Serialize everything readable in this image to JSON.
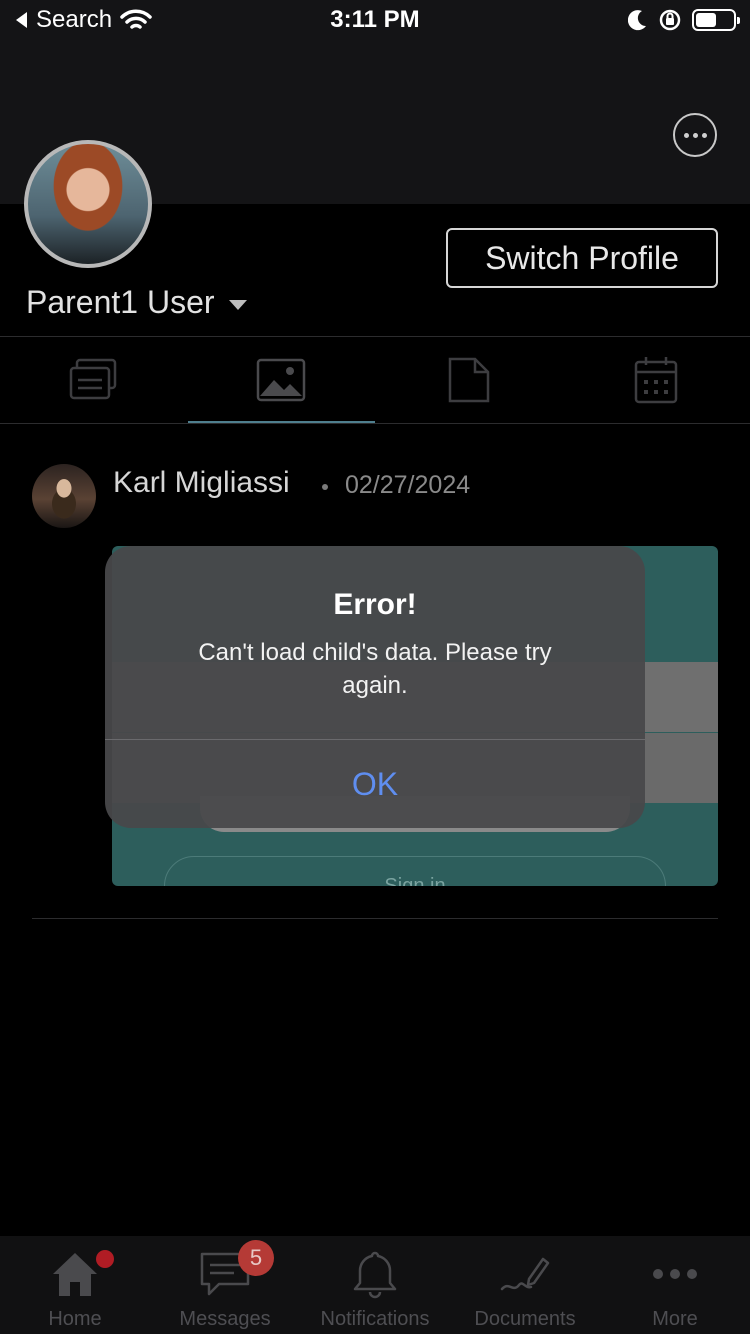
{
  "status_bar": {
    "back_label": "Search",
    "time": "3:11 PM"
  },
  "profile": {
    "name": "Parent1 User",
    "switch_label": "Switch Profile"
  },
  "tabs": [
    {
      "icon": "feed-icon",
      "active": false
    },
    {
      "icon": "image-icon",
      "active": true
    },
    {
      "icon": "document-icon",
      "active": false
    },
    {
      "icon": "calendar-icon",
      "active": false
    }
  ],
  "post": {
    "author": "Karl Migliassi",
    "date": "02/27/2024",
    "image_button_label": "Sign in"
  },
  "alert": {
    "title": "Error!",
    "message": "Can't load child's data. Please try again.",
    "ok_label": "OK"
  },
  "bottom_nav": {
    "home": "Home",
    "messages": "Messages",
    "messages_badge": "5",
    "notifications": "Notifications",
    "documents": "Documents",
    "more": "More"
  },
  "colors": {
    "accent_blue": "#5f8ef0",
    "badge_red": "#b53a36",
    "tab_indicator": "#4f7f8e"
  }
}
